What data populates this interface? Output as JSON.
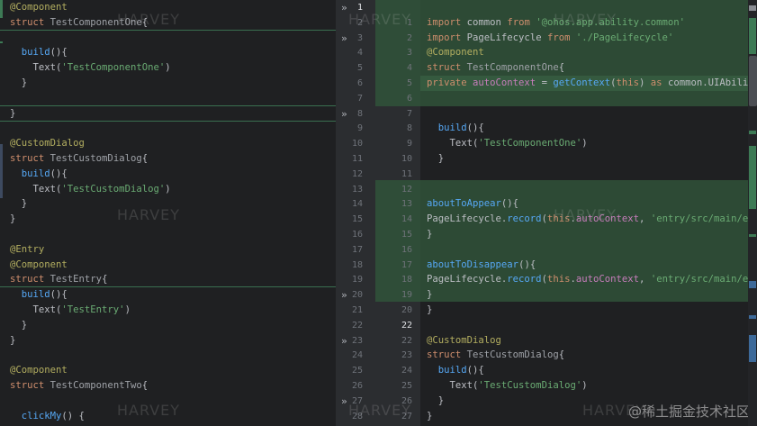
{
  "watermark": "HARVEY",
  "footer_watermark": "@稀土掘金技术社区",
  "left_lines": [
    [
      [
        "tok-ann",
        "@Component"
      ]
    ],
    [
      [
        "tok-kw",
        "struct "
      ],
      [
        "tok-cls",
        "TestComponentOne"
      ],
      [
        "tok-pl",
        "{"
      ]
    ],
    [],
    [
      [
        "tok-pl",
        "  "
      ],
      [
        "tok-fn",
        "build"
      ],
      [
        "tok-pl",
        "(){"
      ]
    ],
    [
      [
        "tok-pl",
        "    Text("
      ],
      [
        "tok-str",
        "'TestComponentOne'"
      ],
      [
        "tok-pl",
        ")"
      ]
    ],
    [
      [
        "tok-pl",
        "  }"
      ]
    ],
    [],
    [
      [
        "tok-pl",
        "}"
      ]
    ],
    [],
    [
      [
        "tok-ann",
        "@CustomDialog"
      ]
    ],
    [
      [
        "tok-kw",
        "struct "
      ],
      [
        "tok-cls",
        "TestCustomDialog"
      ],
      [
        "tok-pl",
        "{"
      ]
    ],
    [
      [
        "tok-pl",
        "  "
      ],
      [
        "tok-fn",
        "build"
      ],
      [
        "tok-pl",
        "(){"
      ]
    ],
    [
      [
        "tok-pl",
        "    Text("
      ],
      [
        "tok-str",
        "'TestCustomDialog'"
      ],
      [
        "tok-pl",
        ")"
      ]
    ],
    [
      [
        "tok-pl",
        "  }"
      ]
    ],
    [
      [
        "tok-pl",
        "}"
      ]
    ],
    [],
    [
      [
        "tok-ann",
        "@Entry"
      ]
    ],
    [
      [
        "tok-ann",
        "@Component"
      ]
    ],
    [
      [
        "tok-kw",
        "struct "
      ],
      [
        "tok-cls",
        "TestEntry"
      ],
      [
        "tok-pl",
        "{"
      ]
    ],
    [
      [
        "tok-pl",
        "  "
      ],
      [
        "tok-fn",
        "build"
      ],
      [
        "tok-pl",
        "(){"
      ]
    ],
    [
      [
        "tok-pl",
        "    Text("
      ],
      [
        "tok-str",
        "'TestEntry'"
      ],
      [
        "tok-pl",
        ")"
      ]
    ],
    [
      [
        "tok-pl",
        "  }"
      ]
    ],
    [
      [
        "tok-pl",
        "}"
      ]
    ],
    [],
    [
      [
        "tok-ann",
        "@Component"
      ]
    ],
    [
      [
        "tok-kw",
        "struct "
      ],
      [
        "tok-cls",
        "TestComponentTwo"
      ],
      [
        "tok-pl",
        "{"
      ]
    ],
    [],
    [
      [
        "tok-pl",
        "  "
      ],
      [
        "tok-fn",
        "clickMy"
      ],
      [
        "tok-pl",
        "() {"
      ]
    ]
  ],
  "gutter_left_numbers": [
    "1",
    "2",
    "3",
    "4",
    "5",
    "6",
    "7",
    "8",
    "9",
    "10",
    "11",
    "12",
    "13",
    "14",
    "15",
    "16",
    "17",
    "18",
    "19",
    "20",
    "21",
    "22",
    "23",
    "24",
    "25",
    "26",
    "27",
    "28"
  ],
  "gutter_right_numbers": [
    "",
    "",
    "",
    "",
    "",
    "",
    "",
    "",
    "",
    "",
    "",
    "",
    "",
    "",
    "",
    "",
    "",
    "",
    "",
    "",
    "",
    "22",
    "",
    "",
    "",
    "",
    "",
    ""
  ],
  "right_lines": [
    [],
    [
      [
        "tok-kw",
        "import "
      ],
      [
        "tok-pl",
        "common "
      ],
      [
        "tok-kw",
        "from "
      ],
      [
        "tok-str",
        "'@ohos.app.ability.common'"
      ]
    ],
    [
      [
        "tok-kw",
        "import "
      ],
      [
        "tok-pl",
        "PageLifecycle "
      ],
      [
        "tok-kw",
        "from "
      ],
      [
        "tok-str",
        "'./PageLifecycle'"
      ]
    ],
    [
      [
        "tok-ann",
        "@Component"
      ]
    ],
    [
      [
        "tok-kw",
        "struct "
      ],
      [
        "tok-cls",
        "TestComponentOne"
      ],
      [
        "tok-pl",
        "{"
      ]
    ],
    [
      [
        "tok-kw",
        "private "
      ],
      [
        "tok-fld",
        "autoContext "
      ],
      [
        "tok-pl",
        "= "
      ],
      [
        "tok-fn",
        "getContext"
      ],
      [
        "tok-pl",
        "("
      ],
      [
        "tok-kw",
        "this"
      ],
      [
        "tok-pl",
        ") "
      ],
      [
        "tok-kw",
        "as "
      ],
      [
        "tok-pl",
        "common.UIAbilityC"
      ]
    ],
    [],
    [],
    [
      [
        "tok-pl",
        "  "
      ],
      [
        "tok-fn",
        "build"
      ],
      [
        "tok-pl",
        "(){"
      ]
    ],
    [
      [
        "tok-pl",
        "    Text("
      ],
      [
        "tok-str",
        "'TestComponentOne'"
      ],
      [
        "tok-pl",
        ")"
      ]
    ],
    [
      [
        "tok-pl",
        "  }"
      ]
    ],
    [],
    [],
    [
      [
        "tok-fn",
        "aboutToAppear"
      ],
      [
        "tok-pl",
        "(){"
      ]
    ],
    [
      [
        "tok-pl",
        "PageLifecycle."
      ],
      [
        "tok-fn",
        "record"
      ],
      [
        "tok-pl",
        "("
      ],
      [
        "tok-kw",
        "this"
      ],
      [
        "tok-pl",
        "."
      ],
      [
        "tok-fld",
        "autoContext"
      ],
      [
        "tok-pl",
        ", "
      ],
      [
        "tok-str",
        "'entry/src/main/ets/"
      ]
    ],
    [
      [
        "tok-pl",
        "}"
      ]
    ],
    [],
    [
      [
        "tok-fn",
        "aboutToDisappear"
      ],
      [
        "tok-pl",
        "(){"
      ]
    ],
    [
      [
        "tok-pl",
        "PageLifecycle."
      ],
      [
        "tok-fn",
        "record"
      ],
      [
        "tok-pl",
        "("
      ],
      [
        "tok-kw",
        "this"
      ],
      [
        "tok-pl",
        "."
      ],
      [
        "tok-fld",
        "autoContext"
      ],
      [
        "tok-pl",
        ", "
      ],
      [
        "tok-str",
        "'entry/src/main/ets/"
      ]
    ],
    [
      [
        "tok-pl",
        "}"
      ]
    ],
    [
      [
        "tok-pl",
        "}"
      ]
    ],
    [],
    [
      [
        "tok-ann",
        "@CustomDialog"
      ]
    ],
    [
      [
        "tok-kw",
        "struct "
      ],
      [
        "tok-cls",
        "TestCustomDialog"
      ],
      [
        "tok-pl",
        "{"
      ]
    ],
    [
      [
        "tok-pl",
        "  "
      ],
      [
        "tok-fn",
        "build"
      ],
      [
        "tok-pl",
        "(){"
      ]
    ],
    [
      [
        "tok-pl",
        "    Text("
      ],
      [
        "tok-str",
        "'TestCustomDialog'"
      ],
      [
        "tok-pl",
        ")"
      ]
    ],
    [
      [
        "tok-pl",
        "  }"
      ]
    ],
    [
      [
        "tok-pl",
        "}"
      ]
    ]
  ],
  "colors": {
    "keyword": "#cf8e6d",
    "annotation": "#b3ae60",
    "string": "#6aab73",
    "function": "#56a8f5",
    "added_bg": "#2d4a35"
  }
}
